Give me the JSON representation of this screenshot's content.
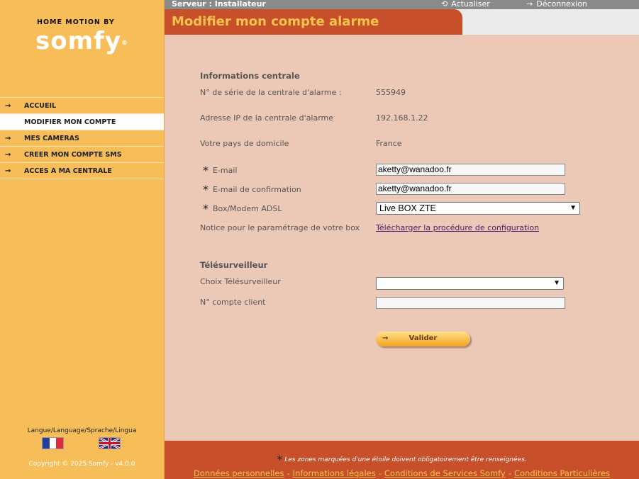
{
  "brand": {
    "top_text": "HOME MOTION BY",
    "name": "somfy",
    "reg": "®"
  },
  "nav": {
    "items": [
      {
        "label": "ACCUEIL",
        "arrow": "→"
      },
      {
        "label": "MODIFIER MON COMPTE",
        "arrow": ""
      },
      {
        "label": "MES CAMERAS",
        "arrow": "→"
      },
      {
        "label": "CREER MON COMPTE SMS",
        "arrow": "→"
      },
      {
        "label": "ACCES A MA CENTRALE",
        "arrow": "→"
      }
    ],
    "active_index": 1
  },
  "language": {
    "label": "Langue/Language/Sprache/Lingua"
  },
  "copyright": "Copyright © 2025 Somfy - v4.0.0",
  "topbar": {
    "server": "Serveur : Installateur",
    "refresh": "Actualiser",
    "logout": "Déconnexion"
  },
  "header": {
    "title": "Modifier mon compte alarme"
  },
  "central": {
    "section_title": "Informations centrale",
    "serial_label": "N° de série de la centrale d'alarme :",
    "serial_value": "555949",
    "ip_label": "Adresse IP de la centrale d'alarme",
    "ip_value": "192.168.1.22",
    "country_label": "Votre pays de domicile",
    "country_value": "France",
    "email_label": "E-mail",
    "email_value": "aketty@wanadoo.fr",
    "email_confirm_label": "E-mail de confirmation",
    "email_confirm_value": "aketty@wanadoo.fr",
    "box_label": "Box/Modem ADSL",
    "box_value": "Live BOX ZTE",
    "notice_label": "Notice pour le paramétrage de votre box",
    "notice_link": "Télécharger la procédure de configuration"
  },
  "telesurv": {
    "section_title": "Télésurveilleur",
    "choice_label": "Choix Télésurveilleur",
    "choice_value": "",
    "client_label": "N° compte client",
    "client_value": ""
  },
  "submit_label": "Valider",
  "footer": {
    "note": "Les zones marquées d'une étoile doivent obligatoirement être renseignées.",
    "links": [
      "Données personnelles",
      "Informations légales",
      "Conditions de Services Somfy",
      "Conditions Particulières"
    ]
  },
  "colors": {
    "sidebar": "#f7bd58",
    "header": "#c7502a",
    "main_bg": "#ecc8b6",
    "title_text": "#f9c34e"
  }
}
